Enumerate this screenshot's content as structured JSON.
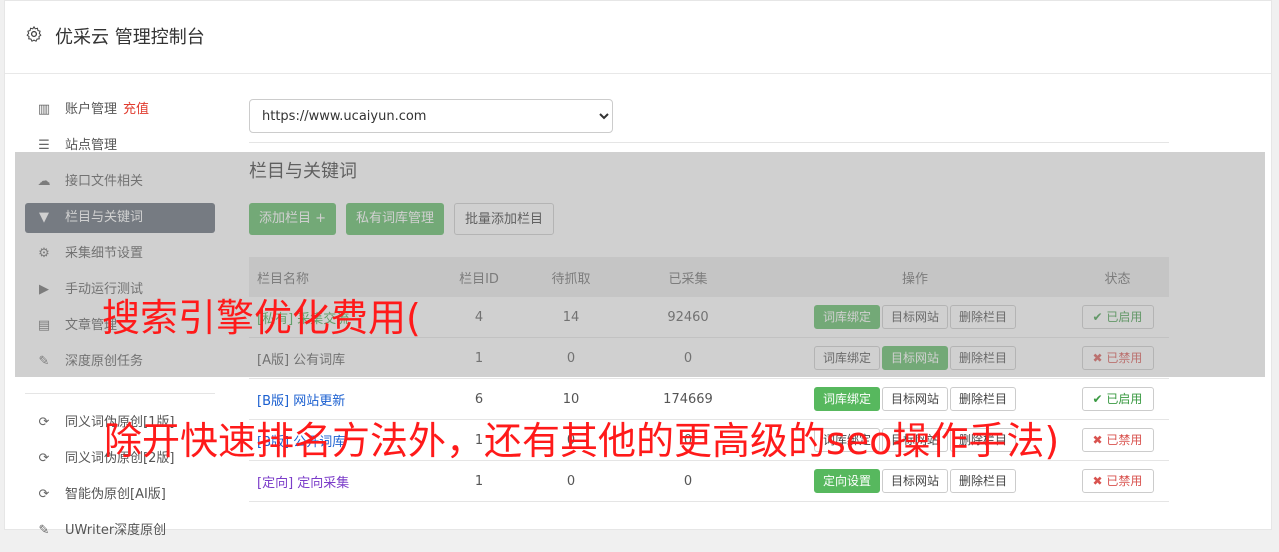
{
  "app": {
    "title": "优采云 管理控制台",
    "icon": "gear-icon"
  },
  "sidebar": {
    "items": [
      {
        "label": "账户管理",
        "badge": "充值",
        "icon": "bar-chart-icon"
      },
      {
        "label": "站点管理",
        "icon": "server-icon"
      },
      {
        "label": "接口文件相关",
        "icon": "cloud-upload-icon"
      },
      {
        "label": "栏目与关键词",
        "icon": "filter-icon",
        "active": true
      },
      {
        "label": "采集细节设置",
        "icon": "cogs-icon"
      },
      {
        "label": "手动运行测试",
        "icon": "play-circle-icon"
      },
      {
        "label": "文章管理",
        "icon": "database-icon"
      },
      {
        "label": "深度原创任务",
        "icon": "edit-icon"
      }
    ],
    "items2": [
      {
        "label": "同义词伪原创[1版]",
        "icon": "refresh-icon"
      },
      {
        "label": "同义词伪原创[2版]",
        "icon": "refresh-icon"
      },
      {
        "label": "智能伪原创[AI版]",
        "icon": "refresh-icon"
      },
      {
        "label": "UWriter深度原创",
        "icon": "edit-icon"
      }
    ]
  },
  "main": {
    "site_select": "https://www.ucaiyun.com",
    "section_title": "栏目与关键词",
    "buttons": {
      "add": "添加栏目 +",
      "private": "私有词库管理",
      "batch": "批量添加栏目"
    },
    "table": {
      "headers": [
        "栏目名称",
        "栏目ID",
        "待抓取",
        "已采集",
        "操作",
        "状态"
      ],
      "rows": [
        {
          "name": "[私有] 采集交流",
          "tag_color": "#3aa845",
          "id": "4",
          "pending": "14",
          "collected": "92460",
          "op1": "词库绑定",
          "op1_style": "green",
          "op2": "目标网站",
          "op2_style": "white",
          "op3": "删除栏目",
          "status": "已启用",
          "status_on": true
        },
        {
          "name": "[A版] 公有词库",
          "tag_color": "#555555",
          "id": "1",
          "pending": "0",
          "collected": "0",
          "op1": "词库绑定",
          "op1_style": "white",
          "op2": "目标网站",
          "op2_style": "green",
          "op3": "删除栏目",
          "status": "已禁用",
          "status_on": false
        },
        {
          "name": "[B版] 网站更新",
          "tag_color": "#1a5fd0",
          "id": "6",
          "pending": "10",
          "collected": "174669",
          "op1": "词库绑定",
          "op1_style": "green",
          "op2": "目标网站",
          "op2_style": "white",
          "op3": "删除栏目",
          "status": "已启用",
          "status_on": true
        },
        {
          "name": "[B版] 公开词库",
          "tag_color": "#1a5fd0",
          "id": "1",
          "pending": "0",
          "collected": "0",
          "op1": "词库绑定",
          "op1_style": "white",
          "op2": "目标网站",
          "op2_style": "white",
          "op3": "删除栏目",
          "status": "已禁用",
          "status_on": false
        },
        {
          "name": "[定向] 定向采集",
          "tag_color": "#7b3cc9",
          "id": "1",
          "pending": "0",
          "collected": "0",
          "op1": "定向设置",
          "op1_style": "green",
          "op2": "目标网站",
          "op2_style": "white",
          "op3": "删除栏目",
          "status": "已禁用",
          "status_on": false
        }
      ]
    }
  },
  "overlay_text": {
    "line1": "搜索引擎优化费用(",
    "line2": "除开快速排名方法外，还有其他的更高级的seo操作手法)"
  }
}
